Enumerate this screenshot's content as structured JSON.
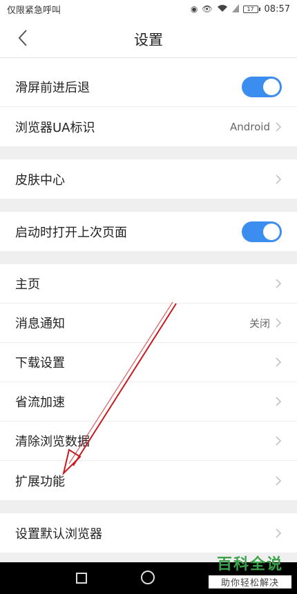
{
  "status_bar": {
    "left_text": "仅限紧急呼叫",
    "battery": "17",
    "time": "08:57"
  },
  "header": {
    "title": "设置"
  },
  "settings": {
    "swipe": {
      "label": "滑屏前进后退",
      "enabled": true
    },
    "ua": {
      "label": "浏览器UA标识",
      "value": "Android"
    },
    "skin": {
      "label": "皮肤中心"
    },
    "restore": {
      "label": "启动时打开上次页面",
      "enabled": true
    },
    "home": {
      "label": "主页"
    },
    "notify": {
      "label": "消息通知",
      "value": "关闭"
    },
    "download": {
      "label": "下载设置"
    },
    "saver": {
      "label": "省流加速"
    },
    "clear": {
      "label": "清除浏览数据"
    },
    "extensions": {
      "label": "扩展功能"
    },
    "default_browser": {
      "label": "设置默认浏览器"
    }
  },
  "watermark": {
    "title": "百科全说",
    "subtitle": "助你轻松解决"
  },
  "colors": {
    "accent": "#3b8ef0",
    "annotation_arrow": "#c8191e",
    "watermark_green": "#3aa34a"
  }
}
